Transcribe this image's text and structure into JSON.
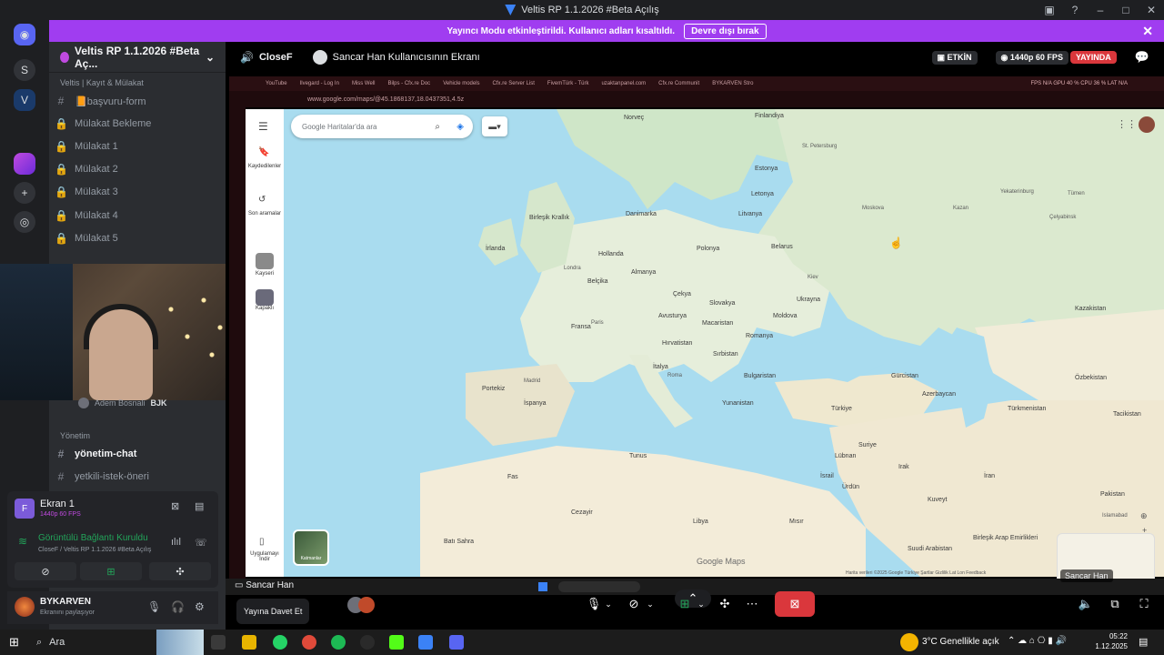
{
  "window": {
    "title": "Veltis RP 1.1.2026 #Beta Açılış"
  },
  "banner": {
    "message": "Yayıncı Modu etkinleştirildi. Kullanıcı adları kısaltıldı.",
    "button": "Devre dışı bırak"
  },
  "rail": {
    "server_initial": "S"
  },
  "server": {
    "name": "Veltis RP 1.1.2026 #Beta Aç..."
  },
  "sidebar": {
    "category1": "Veltis | Kayıt & Mülakat",
    "channels": [
      {
        "label": "📙başvuru-form"
      },
      {
        "label": "Mülakat Bekleme"
      },
      {
        "label": "Mülakat 1"
      },
      {
        "label": "Mülakat 2"
      },
      {
        "label": "Mülakat 3"
      },
      {
        "label": "Mülakat 4"
      },
      {
        "label": "Mülakat 5"
      }
    ],
    "voice_user": "Adem Bosnali",
    "voice_user_tag": "BJK",
    "category2": "Yönetim",
    "channels2": [
      {
        "label": "yönetim-chat"
      },
      {
        "label": "yetkili-istek-öneri"
      }
    ]
  },
  "screen_panel": {
    "title": "Ekran 1",
    "quality": "1440p 60 FPS",
    "connection": "Görüntülü Bağlantı Kuruldu",
    "subtitle": "CloseF / Veltis RP 1.1.2026 #Beta Açılış"
  },
  "userbar": {
    "name": "BYKARVEN",
    "status": "Ekranını paylaşıyor"
  },
  "stream_header": {
    "channel": "CloseF",
    "viewer": "Sancar Han Kullanıcısının Ekranı",
    "badge": "ETKİN",
    "quality": "1440p 60 FPS",
    "live": "YAYINDA"
  },
  "browser": {
    "tabs": [
      "YouTube",
      "Ilvegard - Log In",
      "Miss Well",
      "Bilps - Cfx.re Doc",
      "Vehicle models",
      "Cfx.re Server List",
      "FivemTürk - Türk",
      "uzaktanpanel.com",
      "Cfx.re Communit",
      "BYKARVEN Stro"
    ],
    "url": "www.google.com/maps/@45.1868137,18.0437351,4.5z",
    "perf": "FPS N/A   GPU 40 %   CPU 36 %   LAT N/A"
  },
  "maps": {
    "search_placeholder": "Google Haritalar'da ara",
    "saved": "Kaydedilenler",
    "recent": "Son aramalar",
    "place1": "Kayseri",
    "place2": "Kapaklı",
    "app": "Uygulamayı İndir",
    "layers": "Katmanlar",
    "logo": "Google Maps",
    "footer": "Harita verileri ©2025 Google   Türkiye   Şartlar   Gizlilik   Lat Lon Feedback"
  },
  "map_labels": [
    {
      "t": "Norveç",
      "k": "c"
    },
    {
      "t": "Finlandiya",
      "k": "c"
    },
    {
      "t": "Estonya",
      "k": "c"
    },
    {
      "t": "Letonya",
      "k": "c"
    },
    {
      "t": "Litvanya",
      "k": "c"
    },
    {
      "t": "Danimarka",
      "k": "c"
    },
    {
      "t": "Birleşik Krallık",
      "k": "c"
    },
    {
      "t": "İrlanda",
      "k": "c"
    },
    {
      "t": "Hollanda",
      "k": "c"
    },
    {
      "t": "Almanya",
      "k": "c"
    },
    {
      "t": "Polonya",
      "k": "c"
    },
    {
      "t": "Belarus",
      "k": "c"
    },
    {
      "t": "Belçika",
      "k": "c"
    },
    {
      "t": "Çekya",
      "k": "c"
    },
    {
      "t": "Ukrayna",
      "k": "c"
    },
    {
      "t": "Slovakya",
      "k": "c"
    },
    {
      "t": "Fransa",
      "k": "c"
    },
    {
      "t": "Avusturya",
      "k": "c"
    },
    {
      "t": "Macaristan",
      "k": "c"
    },
    {
      "t": "Moldova",
      "k": "c"
    },
    {
      "t": "Hırvatistan",
      "k": "c"
    },
    {
      "t": "Romanya",
      "k": "c"
    },
    {
      "t": "Sırbistan",
      "k": "c"
    },
    {
      "t": "İtalya",
      "k": "c"
    },
    {
      "t": "Bulgaristan",
      "k": "c"
    },
    {
      "t": "Portekiz",
      "k": "c"
    },
    {
      "t": "İspanya",
      "k": "c"
    },
    {
      "t": "Yunanistan",
      "k": "c"
    },
    {
      "t": "Türkiye",
      "k": "c"
    },
    {
      "t": "Gürcistan",
      "k": "c"
    },
    {
      "t": "Azerbaycan",
      "k": "c"
    },
    {
      "t": "Kazakistan",
      "k": "c"
    },
    {
      "t": "Özbekistan",
      "k": "c"
    },
    {
      "t": "Türkmenistan",
      "k": "c"
    },
    {
      "t": "Tacikistan",
      "k": "c"
    },
    {
      "t": "Tunus",
      "k": "c"
    },
    {
      "t": "Fas",
      "k": "c"
    },
    {
      "t": "Cezayir",
      "k": "c"
    },
    {
      "t": "Libya",
      "k": "c"
    },
    {
      "t": "Mısır",
      "k": "c"
    },
    {
      "t": "Suriye",
      "k": "c"
    },
    {
      "t": "Lübnan",
      "k": "c"
    },
    {
      "t": "Irak",
      "k": "c"
    },
    {
      "t": "İran",
      "k": "c"
    },
    {
      "t": "İsrail",
      "k": "c"
    },
    {
      "t": "Ürdün",
      "k": "c"
    },
    {
      "t": "Kuveyt",
      "k": "c"
    },
    {
      "t": "Suudi Arabistan",
      "k": "c"
    },
    {
      "t": "Birleşik Arap Emirlikleri",
      "k": "c"
    },
    {
      "t": "Pakistan",
      "k": "c"
    },
    {
      "t": "Batı Sahra",
      "k": "c"
    },
    {
      "t": "Moskova",
      "k": "p"
    },
    {
      "t": "St. Petersburg",
      "k": "p"
    },
    {
      "t": "Kazan",
      "k": "p"
    },
    {
      "t": "Londra",
      "k": "p"
    },
    {
      "t": "Paris",
      "k": "p"
    },
    {
      "t": "Roma",
      "k": "p"
    },
    {
      "t": "Madrid",
      "k": "p"
    },
    {
      "t": "Kiev",
      "k": "p"
    },
    {
      "t": "Yekaterinburg",
      "k": "p"
    },
    {
      "t": "Çelyabinsk",
      "k": "p"
    },
    {
      "t": "Tümen",
      "k": "p"
    },
    {
      "t": "Islamabad",
      "k": "p"
    }
  ],
  "controls": {
    "viewer_name": "Sancar Han",
    "invite": "Yayına Davet Et",
    "thumb_label": "Sancar Han"
  },
  "taskbar": {
    "search": "Ara",
    "weather": "3°C  Genellikle açık",
    "time": "05:22",
    "date": "1.12.2025"
  }
}
